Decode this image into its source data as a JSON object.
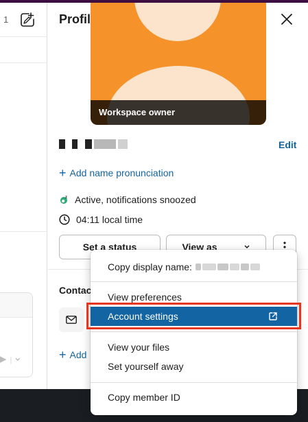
{
  "left_pane": {
    "count": "1",
    "compose_icon": "compose-icon",
    "send_icon": "send-icon",
    "chevron_icon": "chevron-down-icon"
  },
  "profile": {
    "title": "Profile",
    "close_icon": "close-icon",
    "photo_caption": "Workspace owner",
    "edit_label": "Edit",
    "pronunciation_label": "Add name pronunciation",
    "status_text": "Active, notifications snoozed",
    "local_time": "04:11 local time",
    "buttons": {
      "set_status": "Set a status",
      "view_as": "View as"
    },
    "contact_title": "Contac",
    "add_contact_label": "Add"
  },
  "menu": {
    "copy_display_name": "Copy display name:",
    "view_preferences": "View preferences",
    "account_settings": "Account settings",
    "view_your_files": "View your files",
    "set_yourself_away": "Set yourself away",
    "copy_member_id": "Copy member ID"
  },
  "colors": {
    "accent": "#1264a3",
    "photo_bg": "#f5922a",
    "highlight": "#e8361e",
    "active_status": "#2bac76"
  }
}
